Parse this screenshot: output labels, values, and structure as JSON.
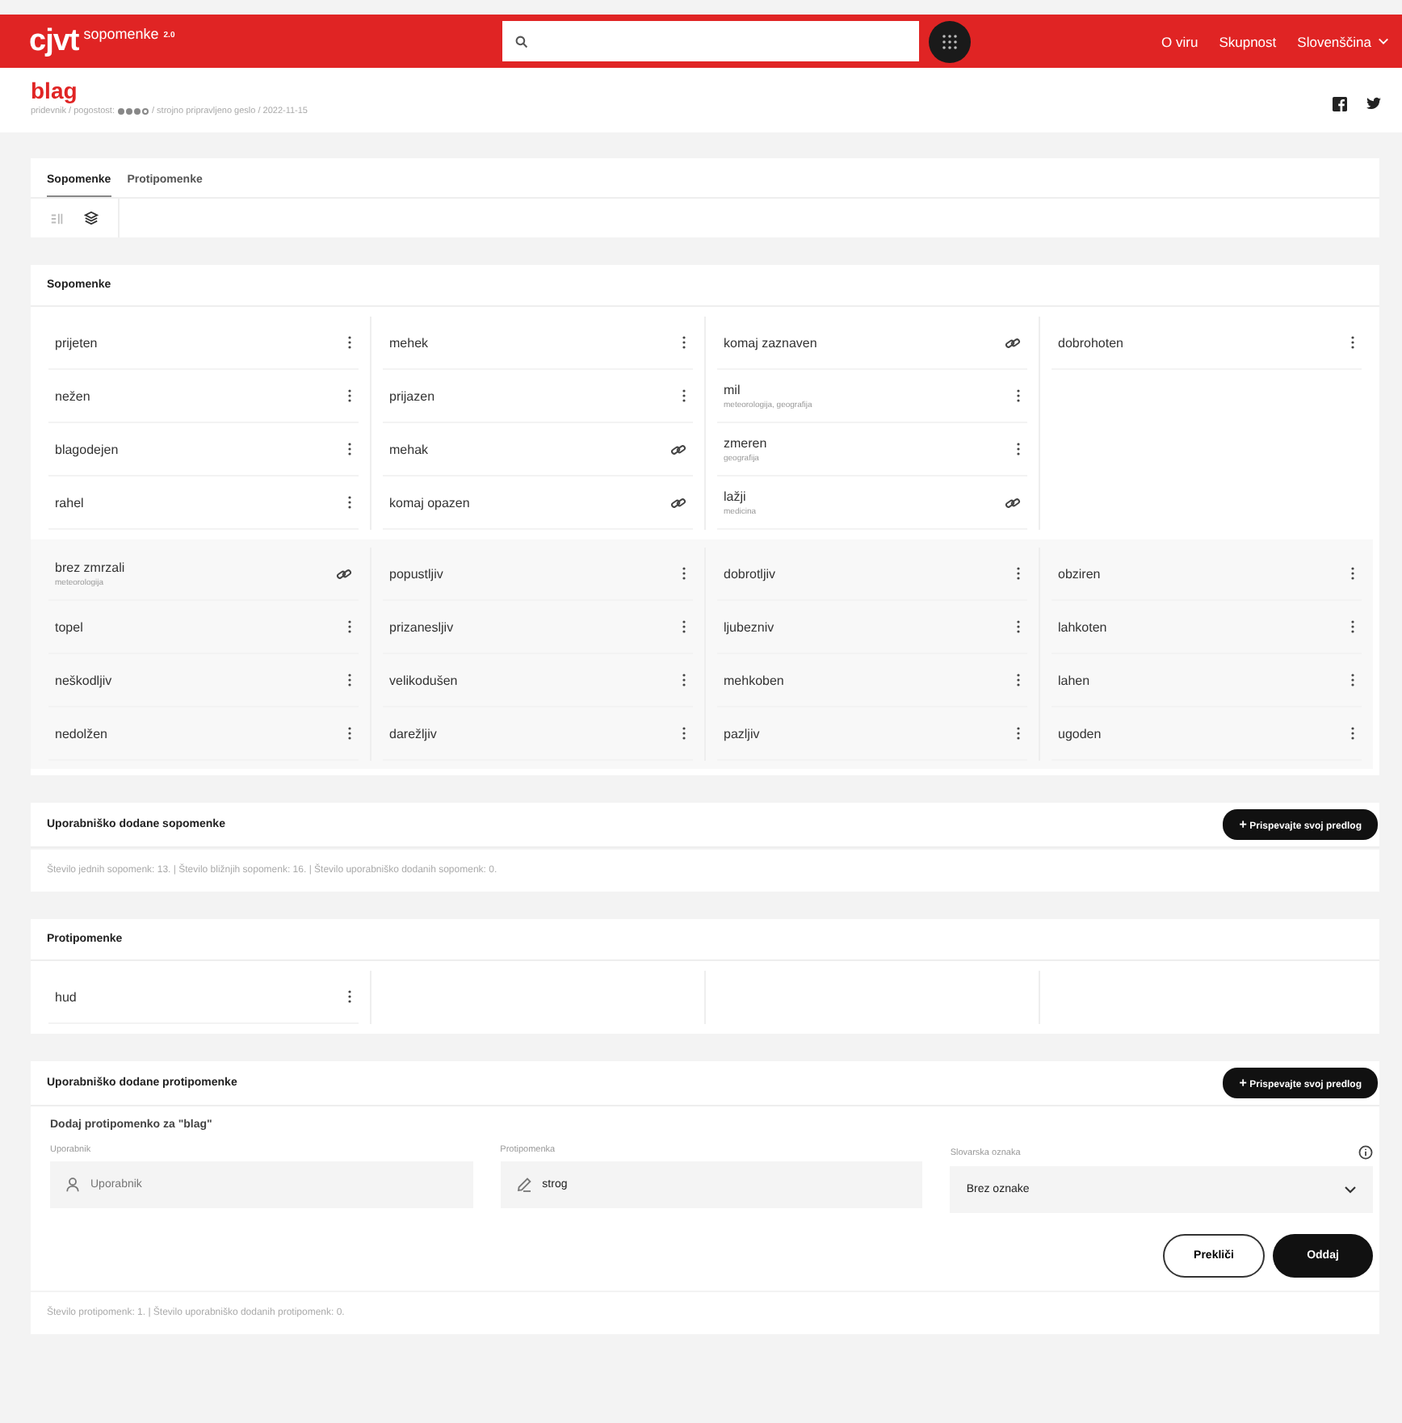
{
  "header": {
    "logo": "cjvt",
    "product": "sopomenke",
    "version": "2.0",
    "nav": [
      {
        "label": "O viru",
        "kind": "link"
      },
      {
        "label": "Skupnost",
        "kind": "link"
      },
      {
        "label": "Slovenščina",
        "kind": "dropdown"
      }
    ]
  },
  "entry": {
    "headword": "blag",
    "pos": "pridevnik / pogostost:",
    "frequency": {
      "stars": 3
    },
    "meta_rest": "/ strojno pripravljeno geslo / 2022-11-15"
  },
  "tabs": [
    {
      "label": "Sopomenke",
      "selected": true
    },
    {
      "label": "Protipomenke",
      "selected": false
    }
  ],
  "synonyms": {
    "title": "Sopomenke",
    "groups": [
      {
        "kind": "plain",
        "columns": [
          [
            {
              "word": "prijeten",
              "kind": "menu"
            },
            {
              "word": "nežen",
              "kind": "menu"
            },
            {
              "word": "blagodejen",
              "kind": "menu"
            },
            {
              "word": "rahel",
              "kind": "menu"
            }
          ],
          [
            {
              "word": "mehek",
              "kind": "menu"
            },
            {
              "word": "prijazen",
              "kind": "menu"
            },
            {
              "word": "mehak",
              "kind": "link"
            },
            {
              "word": "komaj opazen",
              "kind": "link"
            }
          ],
          [
            {
              "word": "komaj zaznaven",
              "kind": "link"
            },
            {
              "word": "mil",
              "note": "meteorologija, geografija",
              "kind": "menu"
            },
            {
              "word": "zmeren",
              "note": "geografija",
              "kind": "menu"
            },
            {
              "word": "lažji",
              "note": "medicina",
              "kind": "link"
            }
          ],
          [
            {
              "word": "dobrohoten",
              "kind": "menu"
            }
          ]
        ]
      },
      {
        "kind": "shaded",
        "columns": [
          [
            {
              "word": "brez zmrzali",
              "note": "meteorologija",
              "kind": "link"
            },
            {
              "word": "topel",
              "kind": "menu"
            },
            {
              "word": "neškodljiv",
              "kind": "menu"
            },
            {
              "word": "nedolžen",
              "kind": "menu"
            }
          ],
          [
            {
              "word": "popustljiv",
              "kind": "menu"
            },
            {
              "word": "prizanesljiv",
              "kind": "menu"
            },
            {
              "word": "velikodušen",
              "kind": "menu"
            },
            {
              "word": "darežljiv",
              "kind": "menu"
            }
          ],
          [
            {
              "word": "dobrotljiv",
              "kind": "menu"
            },
            {
              "word": "ljubezniv",
              "kind": "menu"
            },
            {
              "word": "mehkoben",
              "kind": "menu"
            },
            {
              "word": "pazljiv",
              "kind": "menu"
            }
          ],
          [
            {
              "word": "obziren",
              "kind": "menu"
            },
            {
              "word": "lahkoten",
              "kind": "menu"
            },
            {
              "word": "lahen",
              "kind": "menu"
            },
            {
              "word": "ugoden",
              "kind": "menu"
            }
          ]
        ]
      }
    ]
  },
  "user_synonyms": {
    "title": "Uporabniško dodane sopomenke",
    "button": "Prispevajte svoj predlog",
    "plus": "+",
    "summary": "Število jednih sopomenk: 13. | Število bližnjih sopomenk: 16. | Število uporabniško dodanih sopomenk: 0."
  },
  "antonyms": {
    "title": "Protipomenke",
    "items": [
      {
        "word": "hud",
        "kind": "menu"
      }
    ]
  },
  "user_antonyms": {
    "title": "Uporabniško dodane protipomenke",
    "button": "Prispevajte svoj predlog",
    "plus": "+",
    "form_title": "Dodaj protipomenko za \"blag\"",
    "fields": [
      {
        "label": "Uporabnik",
        "kind": "user",
        "placeholder": "Uporabnik"
      },
      {
        "label": "Protipomenka",
        "kind": "pencil",
        "value": "strog"
      },
      {
        "label": "Slovarska oznaka",
        "kind": "select",
        "value": "Brez oznake"
      }
    ],
    "cancel": "Prekliči",
    "submit": "Oddaj",
    "summary": "Število protipomenk: 1. | Število uporabniško dodanih protipomenk: 0."
  }
}
